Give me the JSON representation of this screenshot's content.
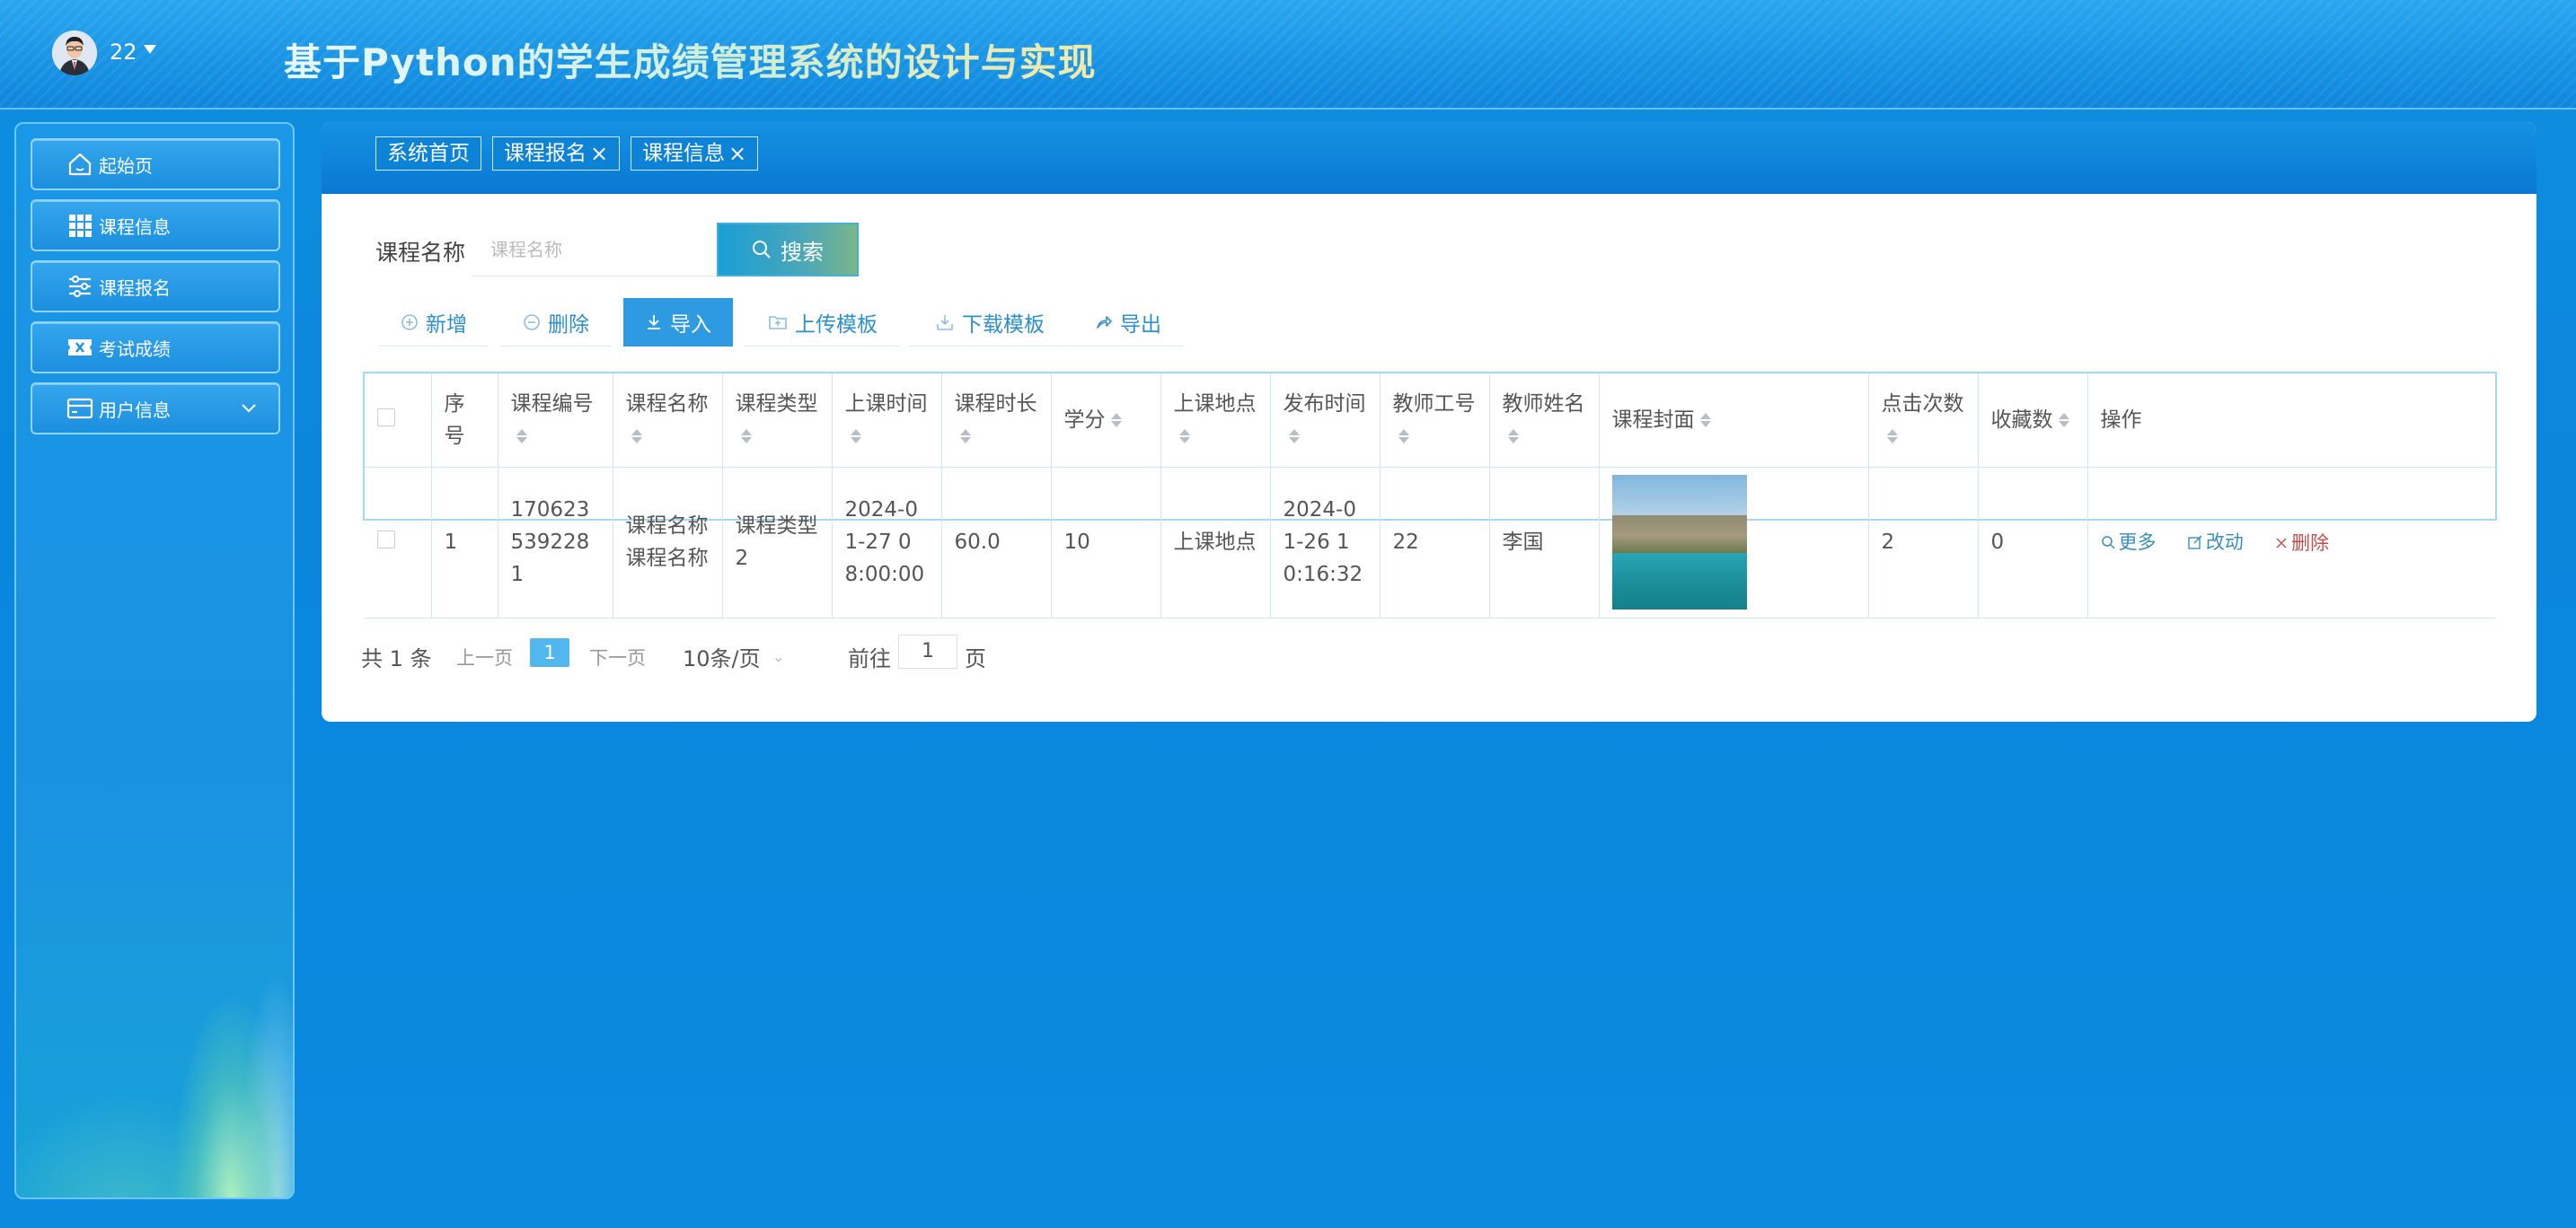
{
  "header": {
    "user_name": "22",
    "title": "基于Python的学生成绩管理系统的设计与实现"
  },
  "sidebar": {
    "items": [
      {
        "label": "起始页",
        "icon": "home-icon"
      },
      {
        "label": "课程信息",
        "icon": "grid-icon"
      },
      {
        "label": "课程报名",
        "icon": "sliders-icon"
      },
      {
        "label": "考试成绩",
        "icon": "ticket-icon"
      },
      {
        "label": "用户信息",
        "icon": "wallet-icon",
        "has_submenu": true
      }
    ]
  },
  "tabs": [
    {
      "label": "系统首页",
      "closable": false
    },
    {
      "label": "课程报名",
      "closable": true
    },
    {
      "label": "课程信息",
      "closable": true
    }
  ],
  "search": {
    "label": "课程名称",
    "placeholder": "课程名称",
    "button_label": "搜索"
  },
  "toolbar": {
    "add_label": "新增",
    "delete_label": "删除",
    "import_label": "导入",
    "upload_template_label": "上传模板",
    "download_template_label": "下载模板",
    "export_label": "导出"
  },
  "table": {
    "columns": [
      "序号",
      "课程编号",
      "课程名称",
      "课程类型",
      "上课时间",
      "课程时长",
      "学分",
      "上课地点",
      "发布时间",
      "教师工号",
      "教师姓名",
      "课程封面",
      "点击次数",
      "收藏数",
      "操作"
    ],
    "rows": [
      {
        "index": "1",
        "course_no": "1706235392281",
        "course_name": "课程名称课程名称",
        "course_type": "课程类型2",
        "class_time": "2024-01-27 08:00:00",
        "duration": "60.0",
        "credit": "10",
        "location": "上课地点",
        "publish_time": "2024-01-26 10:16:32",
        "teacher_no": "22",
        "teacher_name": "李国",
        "clicks": "2",
        "favorites": "0"
      }
    ],
    "actions": {
      "more": "更多",
      "edit": "改动",
      "delete": "删除"
    }
  },
  "pagination": {
    "total": "共 1 条",
    "prev": "上一页",
    "current_page": "1",
    "next": "下一页",
    "page_size": "10条/页",
    "goto_label": "前往",
    "goto_value": "1",
    "page_suffix": "页"
  },
  "colors": {
    "background": "#0b8ae0",
    "accent": "#2d9ae2",
    "delete_red": "#c0504d"
  }
}
